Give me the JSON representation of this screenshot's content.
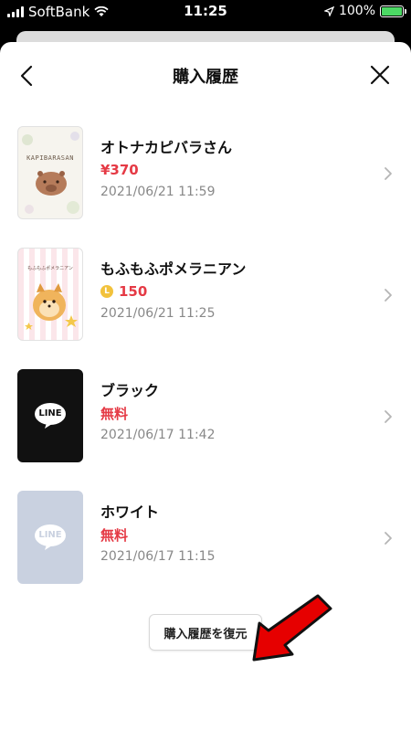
{
  "status_bar": {
    "carrier": "SoftBank",
    "time": "11:25",
    "battery": "100%"
  },
  "header": {
    "title": "購入履歴"
  },
  "purchases": [
    {
      "name": "オトナカピバラさん",
      "price": "¥370",
      "date": "2021/06/21 11:59",
      "thumb_text": "KAPIBARASAN"
    },
    {
      "name": "もふもふポメラニアン",
      "price": "150",
      "coin": "L",
      "date": "2021/06/21 11:25",
      "thumb_text": "もふもふポメラニアン"
    },
    {
      "name": "ブラック",
      "price": "無料",
      "date": "2021/06/17 11:42",
      "thumb_text": "LINE"
    },
    {
      "name": "ホワイト",
      "price": "無料",
      "date": "2021/06/17 11:15",
      "thumb_text": "LINE"
    }
  ],
  "restore_button": {
    "label": "購入履歴を復元"
  },
  "colors": {
    "price_red": "#e53a45",
    "annotation_arrow": "#e60000"
  }
}
